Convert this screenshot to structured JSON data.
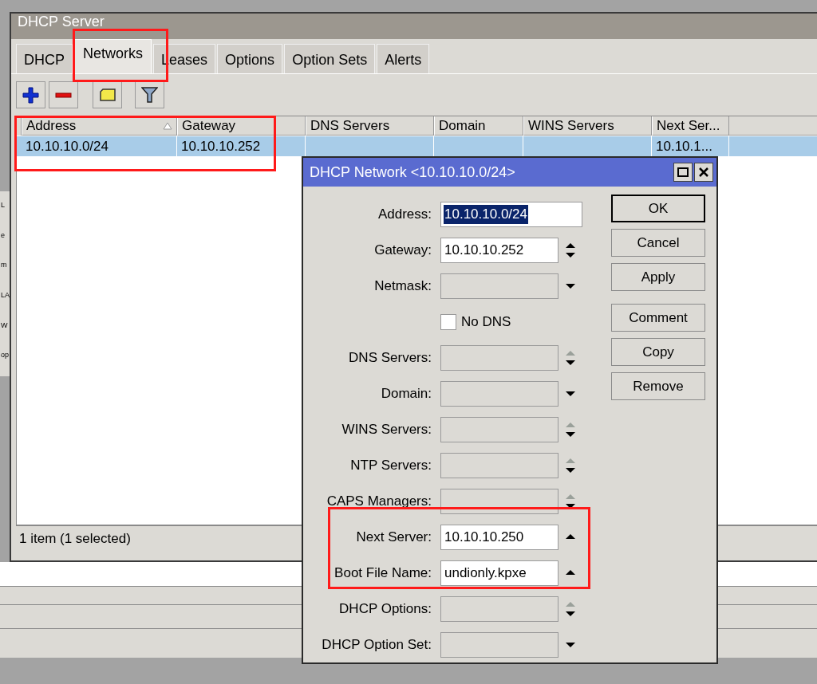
{
  "background_window": {
    "fragments": [
      "L",
      "e",
      "m",
      "LA",
      "W",
      "op"
    ]
  },
  "window": {
    "title": "DHCP Server"
  },
  "tabs": [
    {
      "label": "DHCP",
      "selected": false
    },
    {
      "label": "Networks",
      "selected": true
    },
    {
      "label": "Leases",
      "selected": false
    },
    {
      "label": "Options",
      "selected": false
    },
    {
      "label": "Option Sets",
      "selected": false
    },
    {
      "label": "Alerts",
      "selected": false
    }
  ],
  "toolbar": [
    {
      "kind": "add"
    },
    {
      "kind": "remove"
    },
    {
      "kind": "comment"
    },
    {
      "kind": "filter"
    }
  ],
  "table": {
    "columns": [
      {
        "label": "Address",
        "sorted": true
      },
      {
        "label": "Gateway",
        "sorted": false
      },
      {
        "label": "DNS Servers",
        "sorted": false
      },
      {
        "label": "Domain",
        "sorted": false
      },
      {
        "label": "WINS Servers",
        "sorted": false
      },
      {
        "label": "Next Ser...",
        "sorted": false
      }
    ],
    "rows": [
      {
        "selected": true,
        "cells": [
          "10.10.10.0/24",
          "10.10.10.252",
          null,
          null,
          null,
          "10.10.1..."
        ]
      }
    ]
  },
  "status_bar": "1 item (1 selected)",
  "dialog": {
    "title": "DHCP Network <10.10.10.0/24>",
    "fields": [
      {
        "kind": "plain",
        "label": "Address:",
        "value": "10.10.10.0/24",
        "enabled": true,
        "text_selected": true
      },
      {
        "kind": "spin",
        "label": "Gateway:",
        "value": "10.10.10.252",
        "enabled": true,
        "text_selected": false
      },
      {
        "kind": "dropdown",
        "label": "Netmask:",
        "enabled": false
      },
      {
        "kind": "checkbox",
        "label": "No DNS",
        "checked": false
      },
      {
        "kind": "spindown",
        "label": "DNS Servers:",
        "enabled": false
      },
      {
        "kind": "dropdown",
        "label": "Domain:",
        "enabled": false
      },
      {
        "kind": "spindown",
        "label": "WINS Servers:",
        "enabled": false
      },
      {
        "kind": "spindown",
        "label": "NTP Servers:",
        "enabled": false
      },
      {
        "kind": "spindown",
        "label": "CAPS Managers:",
        "enabled": false
      },
      {
        "kind": "up",
        "label": "Next Server:",
        "value": "10.10.10.250",
        "enabled": true,
        "text_selected": false
      },
      {
        "kind": "up",
        "label": "Boot File Name:",
        "value": "undionly.kpxe",
        "enabled": true,
        "text_selected": false
      },
      {
        "kind": "spindown",
        "label": "DHCP Options:",
        "enabled": false
      },
      {
        "kind": "dropdown",
        "label": "DHCP Option Set:",
        "enabled": false
      }
    ],
    "buttons": [
      {
        "label": "OK",
        "default": true
      },
      {
        "label": "Cancel",
        "default": false
      },
      {
        "label": "Apply",
        "default": false
      },
      {
        "label": "Comment",
        "default": false
      },
      {
        "label": "Copy",
        "default": false
      },
      {
        "label": "Remove",
        "default": false
      }
    ]
  }
}
